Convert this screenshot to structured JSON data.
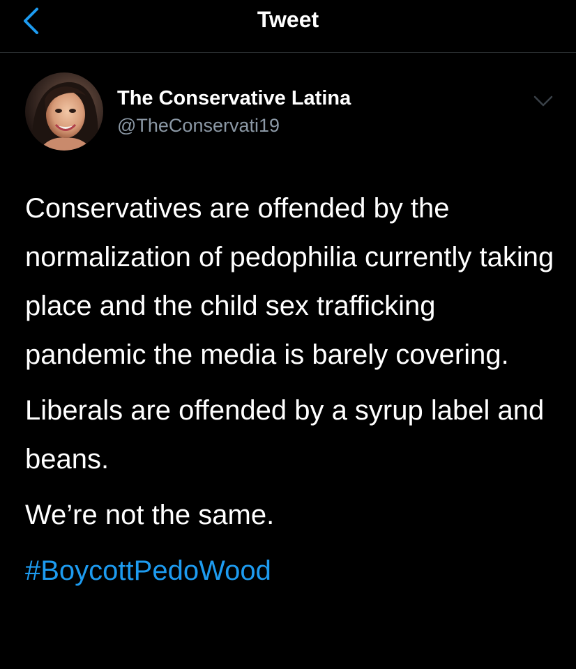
{
  "header": {
    "title": "Tweet",
    "back_icon": "chevron-left-icon",
    "accent_color": "#1d9bf0"
  },
  "author": {
    "display_name": "The Conservative Latina",
    "handle": "@TheConservati19",
    "more_icon": "chevron-down-icon"
  },
  "tweet": {
    "paragraphs": [
      "Conservatives are offended by the normalization of pedophilia currently taking place and the child sex trafficking pandemic the media is barely covering.",
      "Liberals are offended by a syrup label and beans.",
      "We’re not the same."
    ],
    "hashtag": "#BoycottPedoWood",
    "text_color": "#ffffff",
    "hashtag_color": "#1d9bf0"
  }
}
